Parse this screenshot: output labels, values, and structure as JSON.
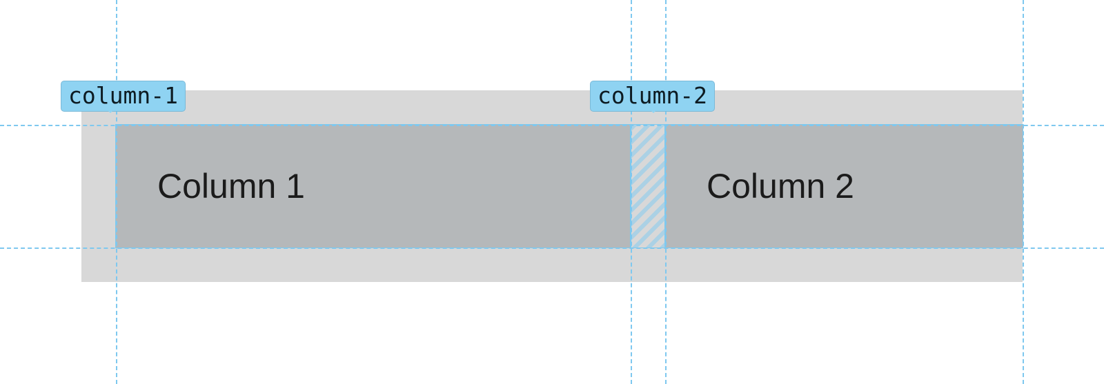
{
  "guides": {
    "horizontal": [
      181,
      359
    ],
    "vertical": [
      168,
      914,
      964,
      1482
    ],
    "color": "#7ec8ef"
  },
  "container": {
    "bg": "#d8d8d8",
    "padding": 50,
    "gap": 50
  },
  "columns": [
    {
      "id": "column-1",
      "tag": "column-1",
      "label": "Column 1"
    },
    {
      "id": "column-2",
      "tag": "column-2",
      "label": "Column 2"
    }
  ],
  "colors": {
    "column_bg": "#b5b8ba",
    "tag_bg": "#8fd3f2",
    "text": "#1b1b1b"
  }
}
